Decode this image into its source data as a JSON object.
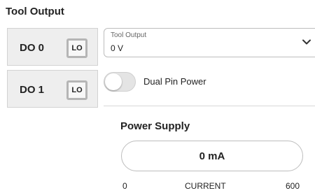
{
  "section_title": "Tool Output",
  "digital_outputs": [
    {
      "label": "DO 0",
      "state": "LO"
    },
    {
      "label": "DO 1",
      "state": "LO"
    }
  ],
  "tool_output_select": {
    "caption": "Tool Output",
    "value": "0 V",
    "icon": "chevron-down-icon"
  },
  "dual_pin_power": {
    "label": "Dual Pin Power",
    "enabled": false
  },
  "power_supply": {
    "title": "Power Supply",
    "readout": "0 mA",
    "scale_min": "0",
    "scale_label": "CURRENT",
    "scale_max": "600"
  }
}
